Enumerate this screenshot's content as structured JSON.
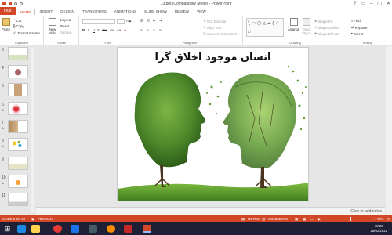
{
  "titlebar": {
    "title": "13.ppt [Compatibility Mode] - PowerPoint"
  },
  "tabs": [
    "FILE",
    "HOME",
    "INSERT",
    "DESIGN",
    "TRANSITIONS",
    "ANIMATIONS",
    "SLIDE SHOW",
    "REVIEW",
    "VIEW"
  ],
  "ribbon": {
    "clipboard": {
      "paste": "Paste",
      "cut": "Cut",
      "copy": "Copy",
      "format_painter": "Format Painter",
      "label": "Clipboard"
    },
    "slides": {
      "new_slide": "New Slide",
      "layout": "Layout",
      "reset": "Reset",
      "section": "Section",
      "label": "Slides"
    },
    "font": {
      "label": "Font",
      "bold": "B",
      "italic": "I",
      "underline": "U",
      "shadow": "S",
      "strike": "abc",
      "char_spacing": "AV",
      "case": "Aa",
      "color": "A"
    },
    "paragraph": {
      "label": "Paragraph",
      "text_direction": "Text Direction",
      "align_text": "Align Text",
      "smartart": "Convert to SmartArt"
    },
    "drawing": {
      "label": "Drawing",
      "arrange": "Arrange",
      "quick_styles": "Quick Styles",
      "shape_fill": "Shape Fill",
      "shape_outline": "Shape Outline",
      "shape_effects": "Shape Effects"
    },
    "editing": {
      "label": "Editing",
      "find": "Find",
      "replace": "Replace",
      "select": "Select"
    }
  },
  "thumbnails": [
    {
      "num": "3"
    },
    {
      "num": "4"
    },
    {
      "num": "5"
    },
    {
      "num": "6"
    },
    {
      "num": "7"
    },
    {
      "num": "8"
    },
    {
      "num": "9"
    },
    {
      "num": "10"
    },
    {
      "num": "11"
    }
  ],
  "slide": {
    "title": "انسان موجود اخلاق گرا"
  },
  "notes": {
    "placeholder": "Click to add notes"
  },
  "status": {
    "slide": "SLIDE 2 OF 22",
    "language": "PERSIAN",
    "notes": "NOTES",
    "comments": "COMMENTS",
    "zoom": "78%"
  },
  "clock": {
    "time": "18:03",
    "date": "28/02/2022"
  },
  "colors": {
    "accent": "#d24726",
    "taskbar": "#1f1f35"
  }
}
